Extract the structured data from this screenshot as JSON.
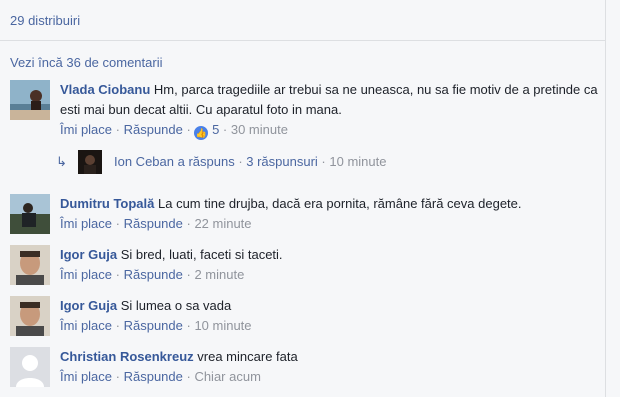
{
  "post": {
    "shares_text": "29 distribuiri",
    "view_more": "Vezi încă 36 de comentarii"
  },
  "actions": {
    "like": "Îmi place",
    "reply": "Răspunde",
    "dot": " · "
  },
  "comments": [
    {
      "author": "Vlada Ciobanu",
      "text": "Hm, parca tragediile ar trebui sa ne uneasca, nu sa fie motiv de a pretinde ca esti mai bun decat altii. Cu aparatul foto in mana.",
      "likes": "5",
      "time": "30 minute",
      "replies": {
        "author_action": "Ion Ceban a răspuns",
        "count": "3 răspunsuri",
        "time": "10 minute"
      }
    },
    {
      "author": "Dumitru Topală",
      "text": "La cum tine drujba, dacă era pornita, rămâne fără ceva degete.",
      "time": "22 minute"
    },
    {
      "author": "Igor Guja",
      "text": "Si bred, luati, faceti si taceti.",
      "time": "2 minute"
    },
    {
      "author": "Igor Guja",
      "text": "Si lumea o sa vada",
      "time": "10 minute"
    },
    {
      "author": "Christian Rosenkreuz",
      "text": "vrea mincare fata",
      "time": "Chiar acum"
    }
  ],
  "colors": {
    "link": "#4b67a1",
    "name": "#365899",
    "meta": "#90949c",
    "like_badge": "#4a81e8",
    "background": "#f6f7f9"
  }
}
